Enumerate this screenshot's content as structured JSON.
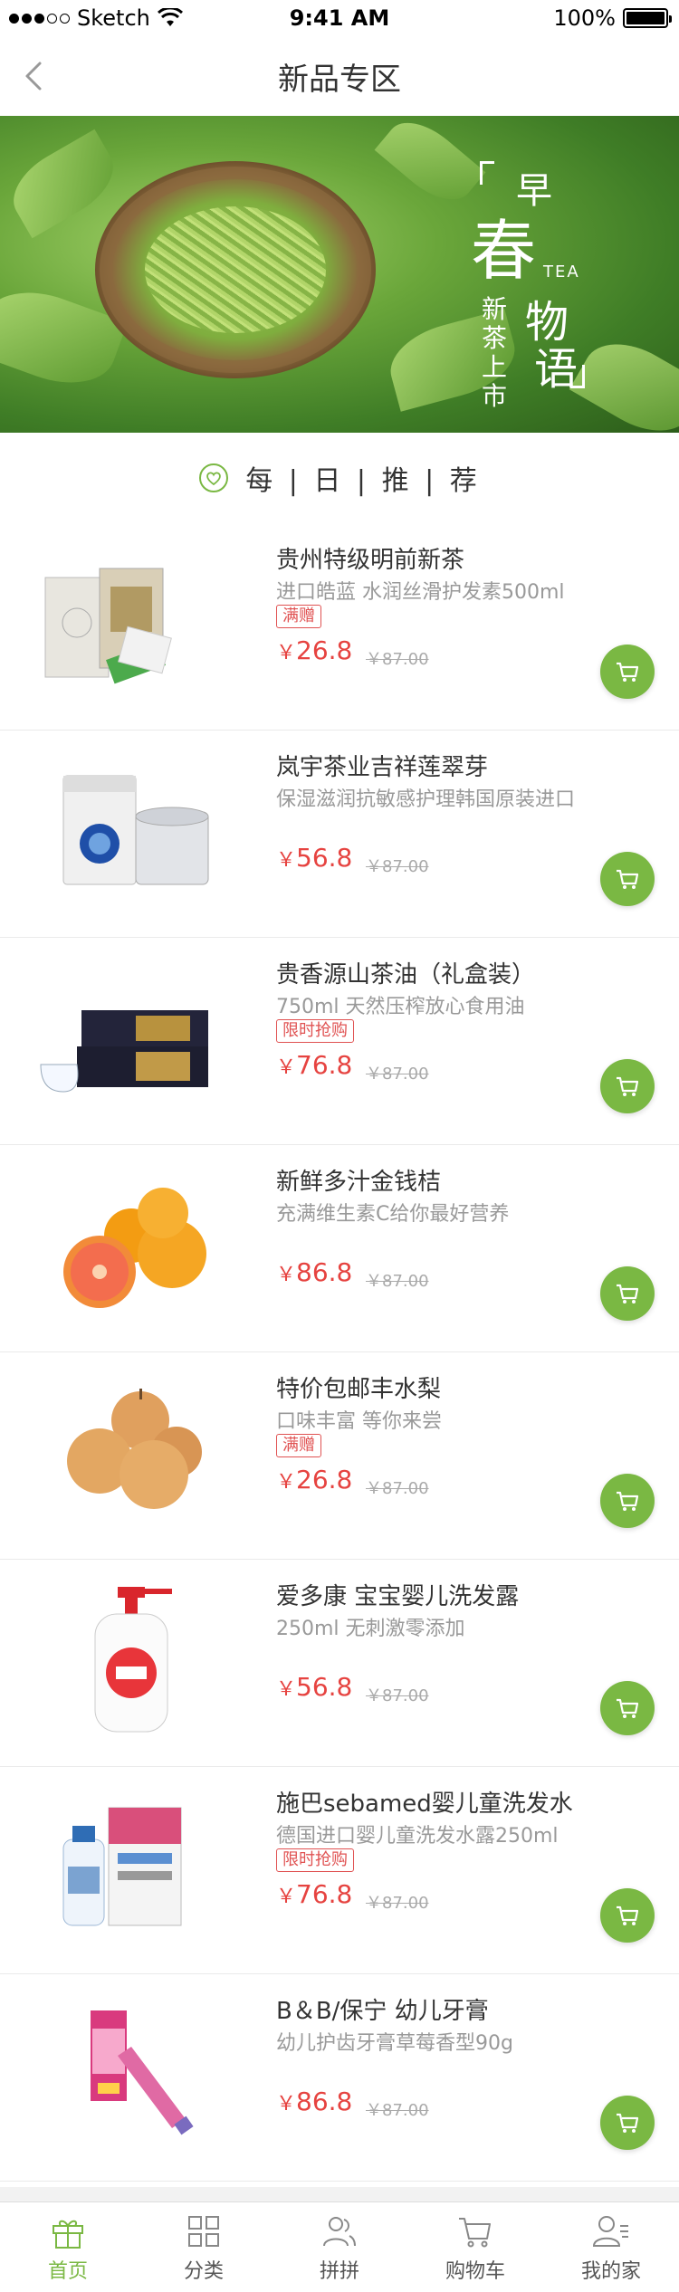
{
  "status_bar": {
    "carrier": "Sketch",
    "time": "9:41 AM",
    "battery": "100%"
  },
  "nav": {
    "title": "新品专区"
  },
  "banner": {
    "zao": "早",
    "chun": "春",
    "tea": "TEA",
    "wu": "物",
    "yu": "语",
    "subtitle": "新茶上市"
  },
  "daily": {
    "text": "每 | 日 | 推 | 荐"
  },
  "colors": {
    "accent": "#7ab843",
    "price": "#e64340",
    "tag": "#e05252"
  },
  "products": [
    {
      "name": "贵州特级明前新茶",
      "desc": "进口皓蓝 水润丝滑护发素500ml",
      "tag": "满赠",
      "yen": "￥",
      "price": "26.8",
      "orig": "￥87.00",
      "image": "tea-boxes"
    },
    {
      "name": "岚宇茶业吉祥莲翠芽",
      "desc": "保湿滋润抗敏感护理韩国原装进口",
      "tag": "",
      "yen": "￥",
      "price": "56.8",
      "orig": "￥87.00",
      "image": "tea-tins"
    },
    {
      "name": "贵香源山茶油（礼盒装）",
      "desc": "750ml 天然压榨放心食用油",
      "tag": "限时抢购",
      "yen": "￥",
      "price": "76.8",
      "orig": "￥87.00",
      "image": "oil-giftbox"
    },
    {
      "name": "新鲜多汁金钱桔",
      "desc": "充满维生素C给你最好营养",
      "tag": "",
      "yen": "￥",
      "price": "86.8",
      "orig": "￥87.00",
      "image": "oranges"
    },
    {
      "name": "特价包邮丰水梨",
      "desc": "口味丰富 等你来尝",
      "tag": "满赠",
      "yen": "￥",
      "price": "26.8",
      "orig": "￥87.00",
      "image": "pears"
    },
    {
      "name": "爱多康 宝宝婴儿洗发露",
      "desc": "250ml 无刺激零添加",
      "tag": "",
      "yen": "￥",
      "price": "56.8",
      "orig": "￥87.00",
      "image": "shampoo-bottle"
    },
    {
      "name": "施巴sebamed婴儿童洗发水",
      "desc": "德国进口婴儿童洗发水露250ml",
      "tag": "限时抢购",
      "yen": "￥",
      "price": "76.8",
      "orig": "￥87.00",
      "image": "children-shampoo"
    },
    {
      "name": "B＆B/保宁 幼儿牙膏",
      "desc": "幼儿护齿牙膏草莓香型90g",
      "tag": "",
      "yen": "￥",
      "price": "86.8",
      "orig": "￥87.00",
      "image": "toothpaste"
    }
  ],
  "tabs": [
    {
      "label": "首页",
      "icon": "gift-icon",
      "active": true
    },
    {
      "label": "分类",
      "icon": "grid-icon",
      "active": false
    },
    {
      "label": "拼拼",
      "icon": "group-icon",
      "active": false
    },
    {
      "label": "购物车",
      "icon": "cart-icon",
      "active": false
    },
    {
      "label": "我的家",
      "icon": "profile-icon",
      "active": false
    }
  ]
}
